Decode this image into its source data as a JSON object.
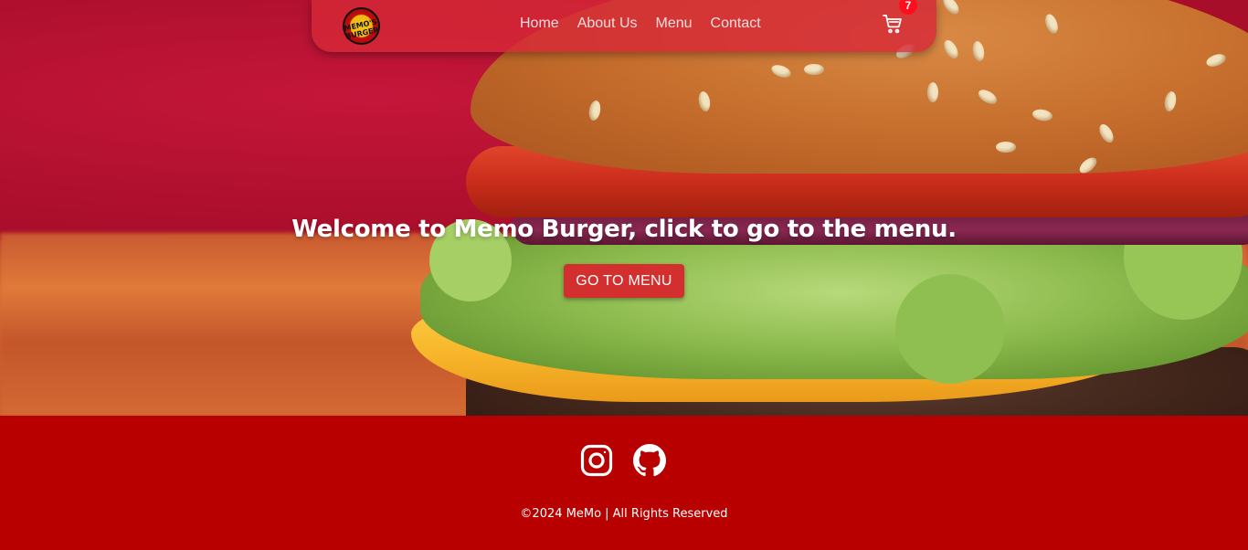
{
  "nav": {
    "logo_text": "MEMO'S BURGER",
    "links": [
      {
        "label": "Home"
      },
      {
        "label": "About Us"
      },
      {
        "label": "Menu"
      },
      {
        "label": "Contact"
      }
    ],
    "cart_icon": "cart-icon",
    "cart_count": "7"
  },
  "hero": {
    "title": "Welcome to Memo Burger, click to go to the menu.",
    "button_label": "GO TO MENU"
  },
  "footer": {
    "social": [
      {
        "name": "instagram-icon"
      },
      {
        "name": "github-icon"
      }
    ],
    "copyright": "©2024 MeMo | All Rights Reserved"
  },
  "colors": {
    "nav_bg": "#d62837",
    "button_bg": "#d32f2f",
    "footer_bg": "#b80000",
    "badge_bg": "#ff0f1e"
  }
}
